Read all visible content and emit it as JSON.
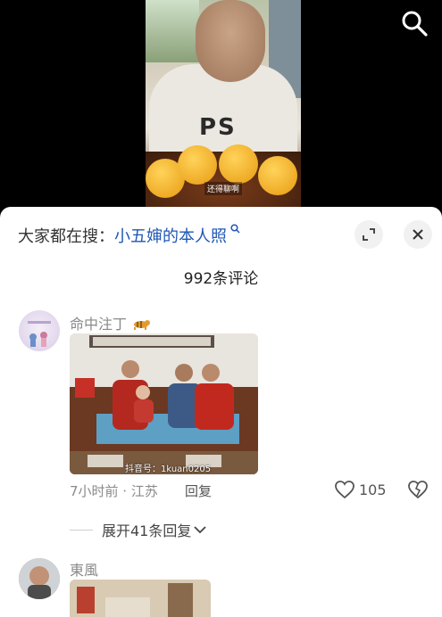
{
  "video": {
    "subtitle": "还得聊啊",
    "shirt_text": "PS"
  },
  "search_icon": "search-icon",
  "sheet": {
    "suggest_prefix": "大家都在搜：",
    "suggest_query": "小五婶的本人照",
    "expand_icon": "expand-icon",
    "close_icon": "close-icon",
    "comment_count": "992条评论"
  },
  "comments": [
    {
      "username": "命中注丁",
      "badge_icon": "tiger-icon",
      "time_location": "7小时前 · 江苏",
      "reply_label": "回复",
      "likes": "105",
      "photo_watermark": "抖音号：1kuan0205",
      "expand_replies": "展开41条回复"
    },
    {
      "username": "東風"
    }
  ],
  "colors": {
    "accent_blue": "#1f56b4",
    "muted_text": "#8a8a8a"
  }
}
